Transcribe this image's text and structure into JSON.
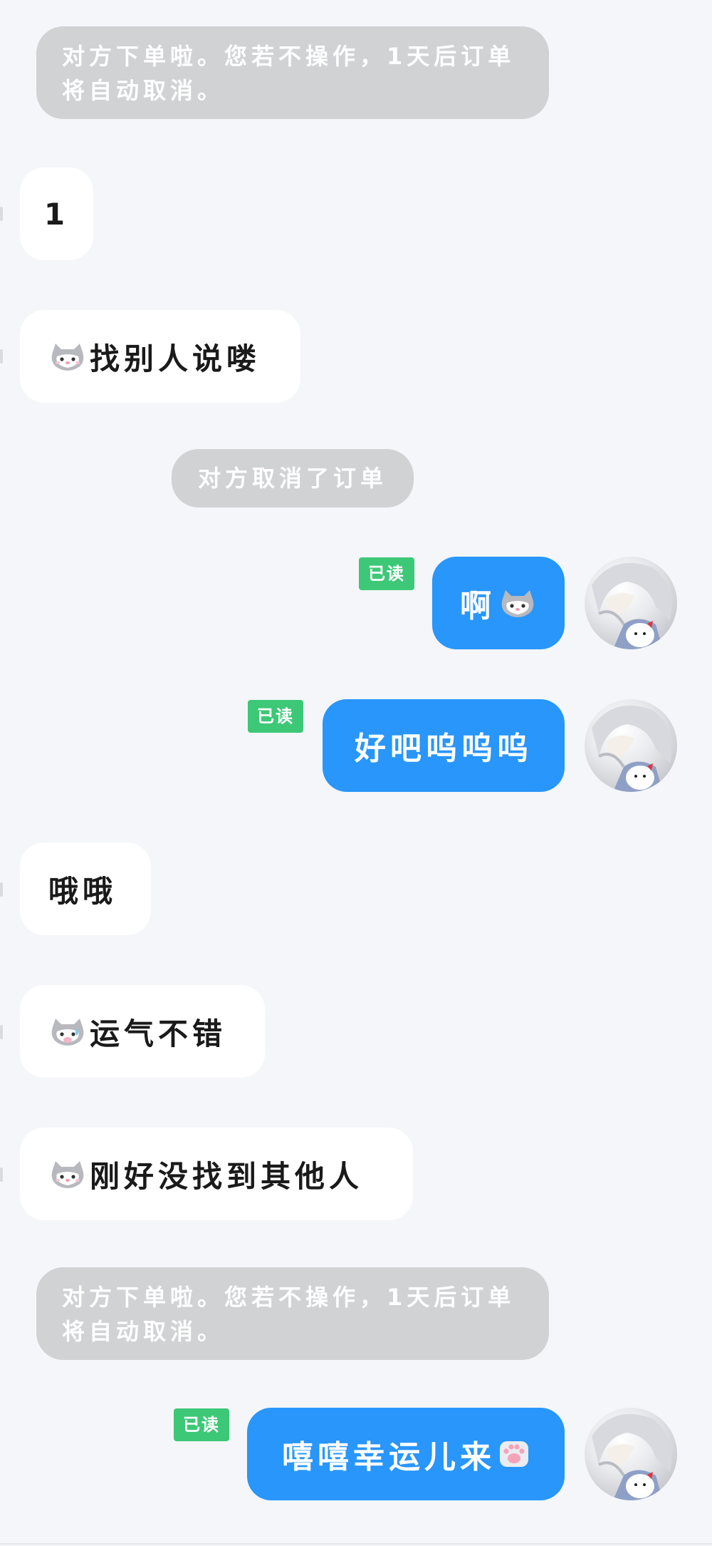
{
  "messages": {
    "sys1": "对方下单啦。您若不操作，1天后订单将自动取消。",
    "in1": "1",
    "in2": "找别人说喽",
    "sys2": "对方取消了订单",
    "out1": "啊",
    "out1_read": "已读",
    "out2": "好吧呜呜呜",
    "out2_read": "已读",
    "in3": "哦哦",
    "in4": "运气不错",
    "in5": "刚好没找到其他人",
    "sys3": "对方下单啦。您若不操作，1天后订单将自动取消。",
    "out3": "嘻嘻幸运儿来",
    "out3_read": "已读"
  },
  "icons": {
    "cat_emoji": "cat-face-icon",
    "paw_emoji": "paw-icon",
    "avatar": "anime-avatar"
  },
  "colors": {
    "background": "#f4f6f9",
    "outgoing_bubble": "#2896fb",
    "incoming_bubble": "#ffffff",
    "system_bubble": "#d1d2d4",
    "read_badge": "#3dc877"
  }
}
